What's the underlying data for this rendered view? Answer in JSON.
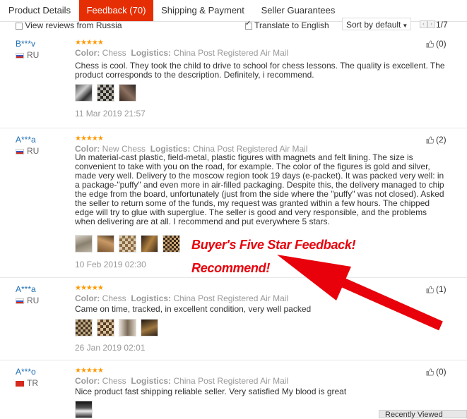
{
  "tabs": [
    {
      "label": "Product Details"
    },
    {
      "label": "Feedback (70)"
    },
    {
      "label": "Shipping & Payment"
    },
    {
      "label": "Seller Guarantees"
    }
  ],
  "toolbar": {
    "view_reviews_label": "View reviews from Russia",
    "translate_label": "Translate to English",
    "sort_label": "Sort by default",
    "page_indicator": "1/7",
    "prev_glyph": "‹",
    "next_glyph": "›"
  },
  "reviews": [
    {
      "user": "B***v",
      "country": "RU",
      "stars": "★★★★★",
      "color_label": "Color:",
      "color_value": "Chess",
      "logistics_label": "Logistics:",
      "logistics_value": "China Post Registered Air Mail",
      "text": "Chess is cool. They took the child to drive to school for chess lessons. The quality is excellent. The product corresponds to the description. Definitely, i recommend.",
      "date": "11 Mar 2019 21:57",
      "likes": "(0)"
    },
    {
      "user": "A***a",
      "country": "RU",
      "stars": "★★★★★",
      "color_label": "Color:",
      "color_value": "New Chess",
      "logistics_label": "Logistics:",
      "logistics_value": "China Post Registered Air Mail",
      "text": "Un material-cast plastic, field-metal, plastic figures with magnets and felt lining. The size is convenient to take with you on the road, for example. The color of the figures is gold and silver, made very well. Delivery to the moscow region took 19 days (e-packet). It was packed very well: in a package-\"puffy\" and even more in air-filled packaging. Despite this, the delivery managed to chip the edge from the board, unfortunately (just from the side where the \"puffy\" was not closed). Asked the seller to return some of the funds, my request was granted within a few hours. The chipped edge will try to glue with superglue. The seller is good and very responsible, and the problems when delivering are at all. I recommend and put everywhere 5 stars.",
      "date": "10 Feb 2019 02:30",
      "likes": "(2)"
    },
    {
      "user": "A***a",
      "country": "RU",
      "stars": "★★★★★",
      "color_label": "Color:",
      "color_value": "Chess",
      "logistics_label": "Logistics:",
      "logistics_value": "China Post Registered Air Mail",
      "text": "Came on time, tracked, in excellent condition, very well packed",
      "date": "26 Jan 2019 02:01",
      "likes": "(1)"
    },
    {
      "user": "A***o",
      "country": "TR",
      "stars": "★★★★★",
      "color_label": "Color:",
      "color_value": "Chess",
      "logistics_label": "Logistics:",
      "logistics_value": "China Post Registered Air Mail",
      "text": "Nice product fast shipping reliable seller. Very satisfied My blood is great",
      "date": "",
      "likes": "(0)"
    }
  ],
  "promo": {
    "line1": "Buyer's Five Star Feedback!",
    "line2": "Recommend!",
    "color": "#e8000b"
  },
  "recent_viewed": "Recently Viewed",
  "colors": {
    "accent": "#e62e04",
    "link": "#1f6fb5",
    "star": "#ff9900"
  }
}
